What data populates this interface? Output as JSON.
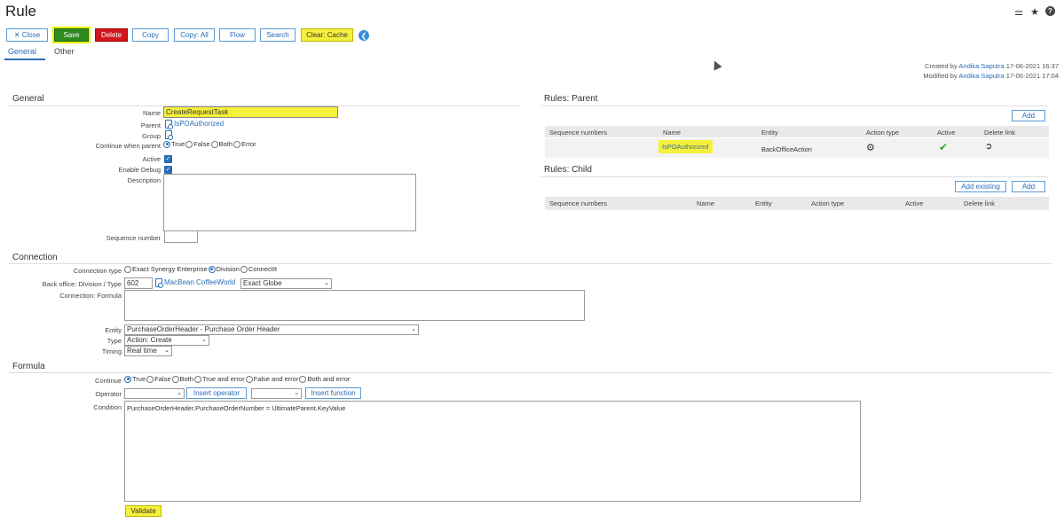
{
  "header": {
    "title": "Rule",
    "icons": [
      "binoculars-icon",
      "star-icon",
      "help-icon"
    ]
  },
  "toolbar": {
    "close_label": "✕ Close",
    "save_label": "Save",
    "delete_label": "Delete",
    "copy_label": "Copy",
    "copy_all_label": "Copy: All",
    "flow_label": "Flow",
    "search_label": "Search",
    "clear_cache_label": "Clear: Cache"
  },
  "tabs": [
    {
      "label": "General",
      "active": true
    },
    {
      "label": "Other",
      "active": false
    }
  ],
  "meta": {
    "created_label": "Created by",
    "created_by": "Andika Saputra",
    "created_date": "17-06-2021 16:37",
    "modified_label": "Modified by",
    "modified_by": "Andika Saputra",
    "modified_date": "17-06-2021 17:04"
  },
  "general": {
    "section_title": "General",
    "name_label": "Name",
    "name_value": "CreateRequestTask",
    "parent_label": "Parent",
    "parent_value": "IsPOAuthorized",
    "group_label": "Group",
    "continue_label": "Continue when parent",
    "continue_options": [
      "True",
      "False",
      "Both",
      "Error"
    ],
    "active_label": "Active",
    "debug_label": "Enable Debug",
    "description_label": "Description",
    "sequence_label": "Sequence number"
  },
  "rules_parent": {
    "title": "Rules: Parent",
    "add_label": "Add",
    "columns": [
      "Sequence numbers",
      "Name",
      "Entity",
      "Action type",
      "Active",
      "Delete link"
    ],
    "rows": [
      {
        "name": "IsPOAuthorized",
        "entity": "BackOfficeAction"
      }
    ]
  },
  "rules_child": {
    "title": "Rules: Child",
    "add_existing_label": "Add existing",
    "add_label": "Add",
    "columns": [
      "Sequence numbers",
      "Name",
      "Entity",
      "Action type",
      "Active",
      "Delete link"
    ]
  },
  "connection": {
    "section_title": "Connection",
    "type_label": "Connection type",
    "type_options": [
      "Exact Synergy Enterprise",
      "Division",
      "ConnectIt"
    ],
    "backoffice_label": "Back office: Division / Type",
    "division_value": "602",
    "division_link": "MacBean CoffeeWorld",
    "type_select": "Exact Globe",
    "formula_label": "Connection: Formula",
    "entity_label": "Entity",
    "entity_value": "PurchaseOrderHeader - Purchase Order Header",
    "action_type_label": "Type",
    "action_type_value": "Action: Create",
    "timing_label": "Timing",
    "timing_value": "Real time"
  },
  "formula": {
    "section_title": "Formula",
    "continue_label": "Continue",
    "continue_options": [
      "True",
      "False",
      "Both",
      "True and error",
      "False and error",
      "Both and error"
    ],
    "operator_label": "Operator",
    "insert_operator_label": "Insert operator",
    "insert_function_label": "Insert function",
    "condition_label": "Condition",
    "condition_value": "PurchaseOrderHeader.PurchaseOrderNumber = UltimateParent.KeyValue",
    "validate_label": "Validate"
  }
}
